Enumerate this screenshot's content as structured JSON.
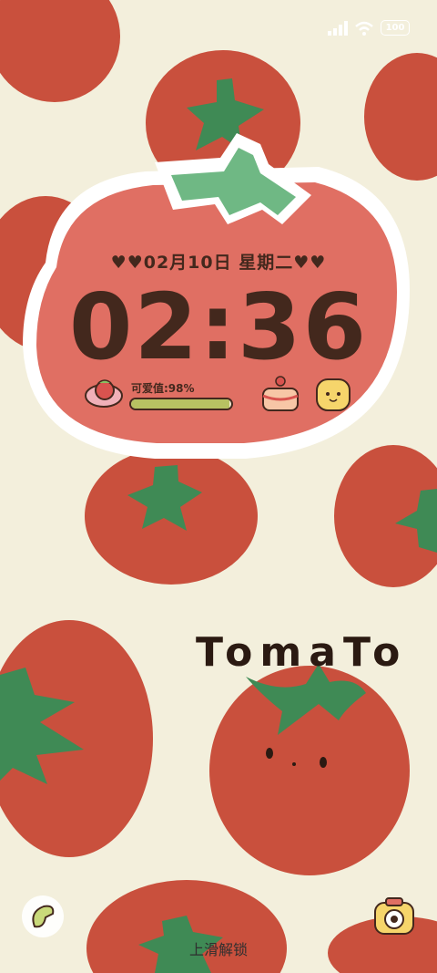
{
  "status_bar": {
    "battery": "100"
  },
  "lock_widget": {
    "date": "♥♥02月10日 星期二♥♥",
    "time": "02:36",
    "cute_value_label": "可爱值:98%",
    "cute_value": 0.98
  },
  "decor": {
    "word": "TomaTo"
  },
  "bottom": {
    "unlock_hint": "上滑解锁"
  },
  "colors": {
    "background": "#f3efdc",
    "tomato": "#c9503d",
    "leaf": "#3f8a55",
    "text": "#43281d"
  }
}
